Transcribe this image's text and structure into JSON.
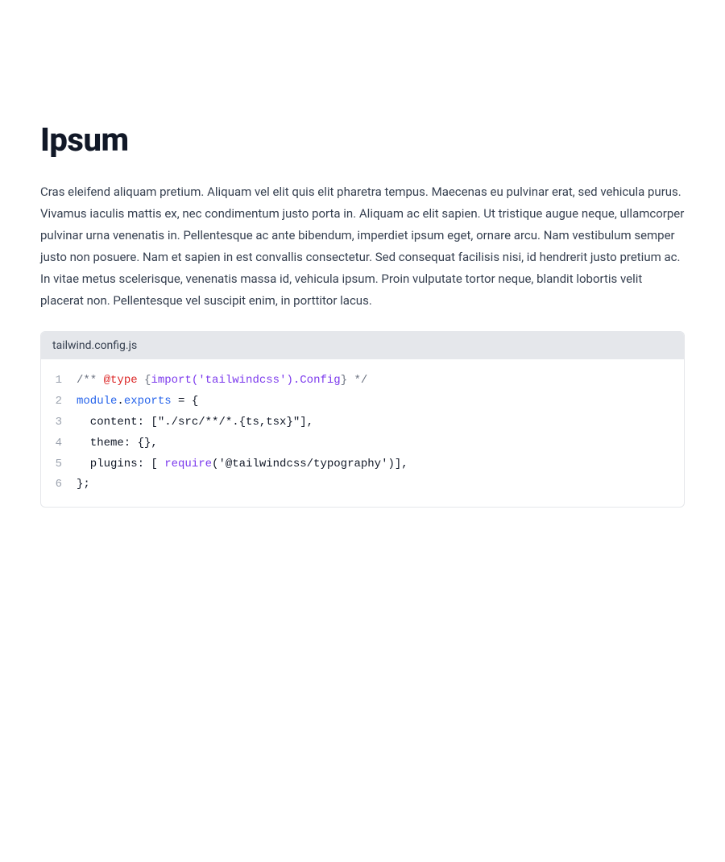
{
  "article": {
    "heading": "Ipsum",
    "paragraph": "Cras eleifend aliquam pretium. Aliquam vel elit quis elit pharetra tempus. Maecenas eu pulvinar erat, sed vehicula purus. Vivamus iaculis mattis ex, nec condimentum justo porta in. Aliquam ac elit sapien. Ut tristique augue neque, ullamcorper pulvinar urna venenatis in. Pellentesque ac ante bibendum, imperdiet ipsum eget, ornare arcu. Nam vestibulum semper justo non posuere. Nam et sapien in est convallis consectetur. Sed consequat facilisis nisi, id hendrerit justo pretium ac. In vitae metus scelerisque, venenatis massa id, vehicula ipsum. Proin vulputate tortor neque, blandit lobortis velit placerat non. Pellentesque vel suscipit enim, in porttitor lacus."
  },
  "code": {
    "filename": "tailwind.config.js",
    "lines": [
      {
        "n": "1",
        "tokens": [
          {
            "cls": "tok-comment",
            "t": "/** "
          },
          {
            "cls": "tok-at",
            "t": "@type"
          },
          {
            "cls": "tok-comment",
            "t": " {"
          },
          {
            "cls": "tok-type",
            "t": "import('tailwindcss').Config"
          },
          {
            "cls": "tok-comment",
            "t": "} */"
          }
        ]
      },
      {
        "n": "2",
        "tokens": [
          {
            "cls": "tok-keyword",
            "t": "module"
          },
          {
            "cls": "tok-punc",
            "t": "."
          },
          {
            "cls": "tok-keyword",
            "t": "exports"
          },
          {
            "cls": "tok-punc",
            "t": " = {"
          }
        ]
      },
      {
        "n": "3",
        "tokens": [
          {
            "cls": "tok-prop",
            "t": "  content: ["
          },
          {
            "cls": "tok-string",
            "t": "\"./src/**/*.{ts,tsx}\""
          },
          {
            "cls": "tok-punc",
            "t": "],"
          }
        ]
      },
      {
        "n": "4",
        "tokens": [
          {
            "cls": "tok-prop",
            "t": "  theme: {},"
          }
        ]
      },
      {
        "n": "5",
        "tokens": [
          {
            "cls": "tok-prop",
            "t": "  plugins: [ "
          },
          {
            "cls": "tok-func",
            "t": "require"
          },
          {
            "cls": "tok-punc",
            "t": "("
          },
          {
            "cls": "tok-string",
            "t": "'@tailwindcss/typography'"
          },
          {
            "cls": "tok-punc",
            "t": ")],"
          }
        ]
      },
      {
        "n": "6",
        "tokens": [
          {
            "cls": "tok-punc",
            "t": "};"
          }
        ]
      }
    ]
  }
}
